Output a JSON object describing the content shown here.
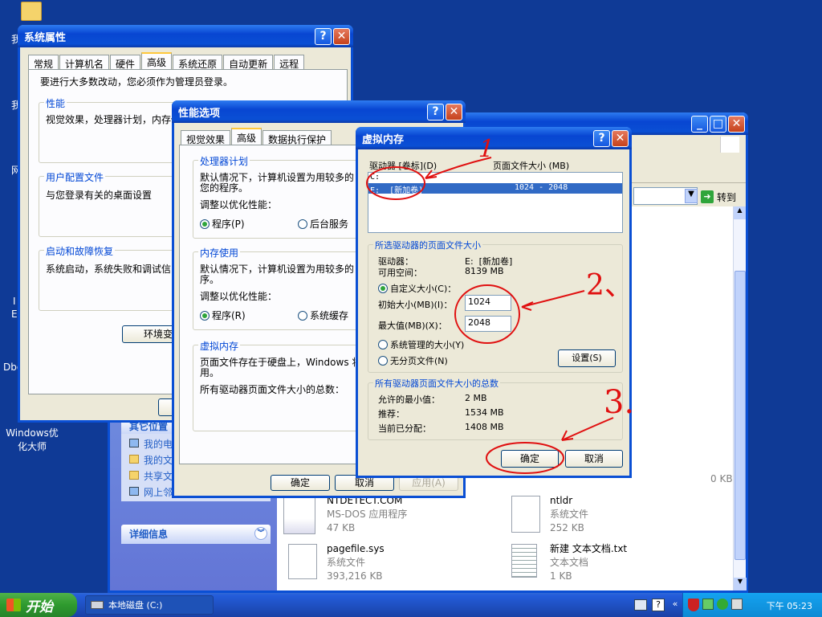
{
  "desktop": {
    "icon_label_line1": "Windows优",
    "icon_label_line2": "化大师",
    "frag_1": "我",
    "frag_2": "我",
    "frag_3": "网",
    "frag_4": "I",
    "frag_5": "E",
    "frag_6": "Dbg"
  },
  "sysprops": {
    "title": "系统属性",
    "tabs": [
      "常规",
      "计算机名",
      "硬件",
      "高级",
      "系统还原",
      "自动更新",
      "远程"
    ],
    "admin_note": "要进行大多数改动，您必须作为管理员登录。",
    "perf_legend": "性能",
    "perf_text": "视觉效果，处理器计划，内存使",
    "profile_legend": "用户配置文件",
    "profile_text": "与您登录有关的桌面设置",
    "startup_legend": "启动和故障恢复",
    "startup_text": "系统启动，系统失败和调试信，",
    "env_button": "环境变"
  },
  "perfopts": {
    "title": "性能选项",
    "tabs": [
      "视觉效果",
      "高级",
      "数据执行保护"
    ],
    "cpu_legend": "处理器计划",
    "cpu_text1": "默认情况下，计算机设置为用较多的",
    "cpu_text2": "您的程序。",
    "cpu_adjust": "调整以优化性能：",
    "cpu_opt1": "程序(P)",
    "cpu_opt2": "后台服务",
    "mem_legend": "内存使用",
    "mem_text1": "默认情况下，计算机设置为用较多的",
    "mem_text2": "序。",
    "mem_adjust": "调整以优化性能：",
    "mem_opt1": "程序(R)",
    "mem_opt2": "系统缓存",
    "vm_legend": "虚拟内存",
    "vm_text1": "页面文件存在于硬盘上，Windows 将",
    "vm_text2": "用。",
    "vm_total": "所有驱动器页面文件大小的总数：",
    "ok": "确定",
    "cancel": "取消",
    "apply": "应用(A)"
  },
  "explorer": {
    "go_label": "转到",
    "other_places_head": "其它位置",
    "places": [
      "我的电",
      "我的文",
      "共享文",
      "网上邻"
    ],
    "details_head": "详细信息",
    "files": [
      {
        "name": "NTDETECT.COM",
        "type": "MS-DOS 应用程序",
        "size": "47 KB"
      },
      {
        "name": "ntldr",
        "type": "系统文件",
        "size": "252 KB"
      },
      {
        "name": "pagefile.sys",
        "type": "系统文件",
        "size": "393,216 KB"
      },
      {
        "name": "新建 文本文档.txt",
        "type": "文本文档",
        "size": "1 KB"
      }
    ],
    "partial_size": "0 KB"
  },
  "vmem": {
    "title": "虚拟内存",
    "col_drive": "驱动器 [卷标](D)",
    "col_size": "页面文件大小 (MB)",
    "drives": [
      {
        "drive": "C:",
        "size": ""
      },
      {
        "drive": "E:  [新加卷]",
        "size": "1024 - 2048"
      }
    ],
    "selected_legend": "所选驱动器的页面文件大小",
    "drive_label": "驱动器：",
    "drive_value": "E:  [新加卷]",
    "space_label": "可用空间：",
    "space_value": "8139 MB",
    "custom_size": "自定义大小(C)：",
    "initial_label": "初始大小(MB)(I)：",
    "initial_value": "1024",
    "max_label": "最大值(MB)(X)：",
    "max_value": "2048",
    "system_managed": "系统管理的大小(Y)",
    "no_paging": "无分页文件(N)",
    "set_button": "设置(S)",
    "total_legend": "所有驱动器页面文件大小的总数",
    "min_label": "允许的最小值：",
    "min_value": "2 MB",
    "rec_label": "推荐：",
    "rec_value": "1534 MB",
    "cur_label": "当前已分配：",
    "cur_value": "1408 MB",
    "ok": "确定",
    "cancel": "取消"
  },
  "annotations": {
    "step1": "1",
    "step2": "2、",
    "step3": "3."
  },
  "taskbar": {
    "start": "开始",
    "task": "本地磁盘 (C:)",
    "clock": "下午 05:23"
  }
}
